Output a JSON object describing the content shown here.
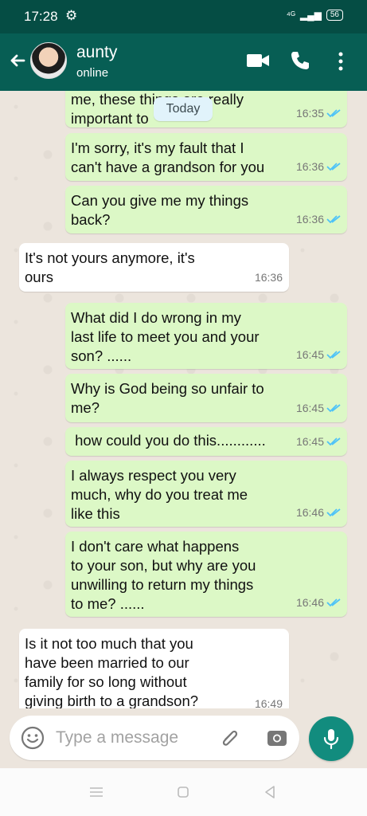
{
  "status_bar": {
    "time": "17:28",
    "settings_icon": "gear-icon",
    "network": "⁴ᴳ",
    "battery": "56"
  },
  "header": {
    "back_icon": "arrow-left-icon",
    "contact_name": "aunty",
    "contact_status": "online",
    "video_icon": "video-call-icon",
    "call_icon": "phone-icon",
    "menu_icon": "more-vertical-icon",
    "accent_color": "#075e54"
  },
  "chat": {
    "date_chip": "Today",
    "messages": [
      {
        "direction": "out",
        "text": "me, these things are really\nimportant to",
        "time": "16:35",
        "read": true
      },
      {
        "direction": "out",
        "text": "I'm sorry, it's my fault that I\ncan't have a grandson for you",
        "time": "16:36",
        "read": true
      },
      {
        "direction": "out",
        "text": "Can you give me my things\nback?",
        "time": "16:36",
        "read": true
      },
      {
        "direction": "in",
        "text": "It's not yours anymore, it's\nours",
        "time": "16:36",
        "read": false
      },
      {
        "direction": "out",
        "text": "What did I do wrong in my\nlast life to meet you and your\nson? ......",
        "time": "16:45",
        "read": true
      },
      {
        "direction": "out",
        "text": "Why is God being so unfair to\nme?",
        "time": "16:45",
        "read": true
      },
      {
        "direction": "out",
        "text": " how could you do this............",
        "time": "16:45",
        "read": true
      },
      {
        "direction": "out",
        "text": "I always respect you very\nmuch, why do you treat me\nlike this",
        "time": "16:46",
        "read": true
      },
      {
        "direction": "out",
        "text": "I don't care what happens\nto your son, but why are you\nunwilling to return my things\nto me? ......",
        "time": "16:46",
        "read": true
      },
      {
        "direction": "in",
        "text": "Is it not too much that you\nhave been married to our\nfamily for so long without\ngiving birth to a grandson?",
        "time": "16:49",
        "read": false
      }
    ],
    "outgoing_color": "#dcf8c6",
    "incoming_color": "#ffffff",
    "read_tick_color": "#4fc3f7"
  },
  "composer": {
    "emoji_icon": "emoji-icon",
    "placeholder": "Type a message",
    "value": "",
    "attach_icon": "paperclip-icon",
    "camera_icon": "camera-icon",
    "mic_icon": "microphone-icon"
  },
  "navigation": {
    "menu_icon": "menu-icon",
    "home_icon": "home-icon",
    "back_icon": "back-triangle-icon"
  }
}
